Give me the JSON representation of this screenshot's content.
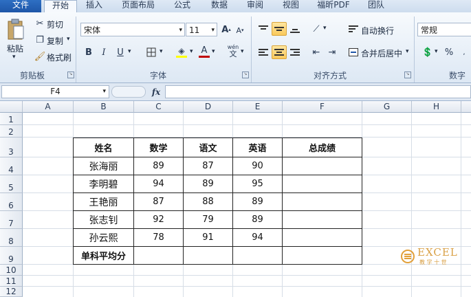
{
  "tabs": [
    "文件",
    "开始",
    "插入",
    "页面布局",
    "公式",
    "数据",
    "审阅",
    "视图",
    "福昕PDF",
    "团队"
  ],
  "clipboard": {
    "paste": "粘贴",
    "cut": "剪切",
    "copy": "复制",
    "format_painter": "格式刷",
    "label": "剪贴板"
  },
  "font": {
    "name": "宋体",
    "size": "11",
    "bold": "B",
    "italic": "I",
    "underline": "U",
    "label": "字体",
    "grow": "A",
    "shrink": "A",
    "color_a": "A",
    "wen": "wén"
  },
  "alignment": {
    "wrap": "自动换行",
    "merge": "合并后居中",
    "label": "对齐方式"
  },
  "number": {
    "format": "常规",
    "label": "数字",
    "percent": "%"
  },
  "name_box": "F4",
  "fx": "fx",
  "columns": [
    "A",
    "B",
    "C",
    "D",
    "E",
    "F",
    "G",
    "H"
  ],
  "rows": [
    "1",
    "2",
    "3",
    "4",
    "5",
    "6",
    "7",
    "8",
    "9",
    "10",
    "11",
    "12"
  ],
  "table": {
    "headers": [
      "姓名",
      "数学",
      "语文",
      "英语",
      "总成绩"
    ],
    "rows": [
      [
        "张海丽",
        "89",
        "87",
        "90",
        ""
      ],
      [
        "李明碧",
        "94",
        "89",
        "95",
        ""
      ],
      [
        "王艳丽",
        "87",
        "88",
        "89",
        ""
      ],
      [
        "张志钊",
        "92",
        "79",
        "89",
        ""
      ],
      [
        "孙云熙",
        "78",
        "91",
        "94",
        ""
      ]
    ],
    "footer": [
      "单科平均分",
      "",
      "",
      "",
      ""
    ]
  },
  "watermark": {
    "title": "EXCEL",
    "subtitle": "教 学 十 世"
  },
  "colors": {
    "accent": "#1e56a8",
    "highlight": "#f9c95c",
    "font_color": "#c00000",
    "fill_color": "#ffff00"
  }
}
